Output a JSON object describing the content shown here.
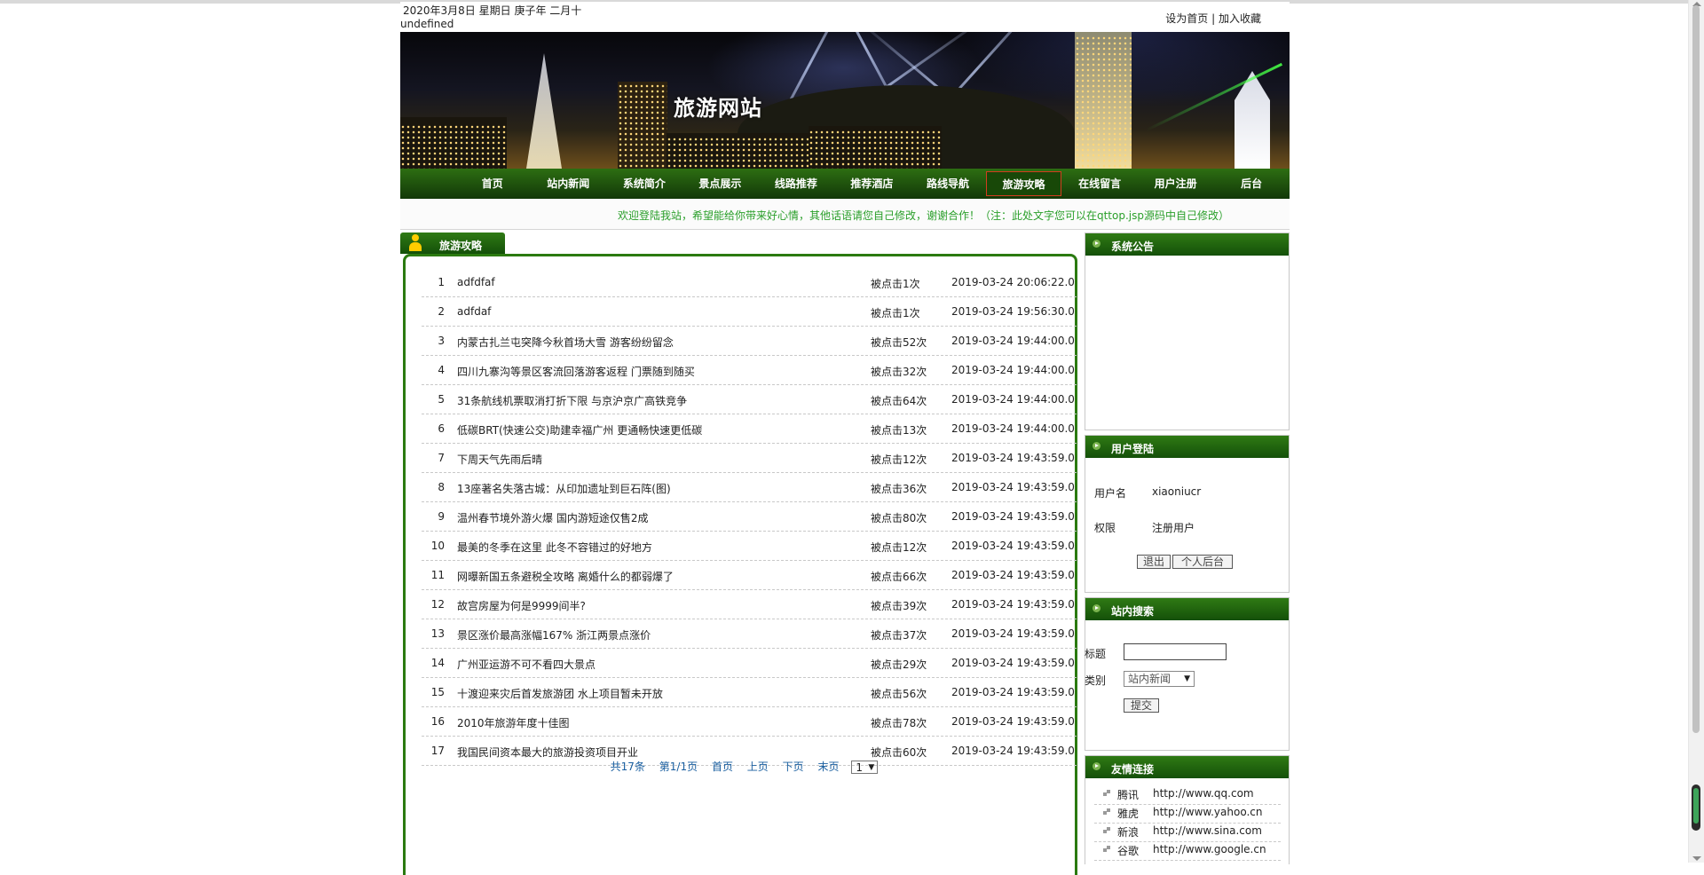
{
  "topbar": {
    "date": "2020年3月8日 星期日 庚子年 二月十",
    "undefined_text": "undefined",
    "set_home": "设为首页",
    "separator": "|",
    "add_favorite": "加入收藏"
  },
  "banner": {
    "title": "旅游网站"
  },
  "nav": {
    "items": [
      "首页",
      "站内新闻",
      "系统简介",
      "景点展示",
      "线路推荐",
      "推荐酒店",
      "路线导航",
      "旅游攻略",
      "在线留言",
      "用户注册",
      "后台"
    ],
    "active": "旅游攻略"
  },
  "welcome": {
    "text": "欢迎登陆我站，希望能给你带来好心情，其他话语请您自己修改，谢谢合作！（注：此处文字您可以在qttop.jsp源码中自己修改）"
  },
  "main": {
    "tab_label": "旅游攻略",
    "articles": [
      {
        "num": "1",
        "title": "adfdfaf",
        "clicks": "被点击1次",
        "date": "2019-03-24 20:06:22.0"
      },
      {
        "num": "2",
        "title": "adfdaf",
        "clicks": "被点击1次",
        "date": "2019-03-24 19:56:30.0"
      },
      {
        "num": "3",
        "title": "内蒙古扎兰屯突降今秋首场大雪 游客纷纷留念",
        "clicks": "被点击52次",
        "date": "2019-03-24 19:44:00.0"
      },
      {
        "num": "4",
        "title": "四川九寨沟等景区客流回落游客返程 门票随到随买",
        "clicks": "被点击32次",
        "date": "2019-03-24 19:44:00.0"
      },
      {
        "num": "5",
        "title": "31条航线机票取消打折下限 与京沪京广高铁竞争",
        "clicks": "被点击64次",
        "date": "2019-03-24 19:44:00.0"
      },
      {
        "num": "6",
        "title": "低碳BRT(快速公交)助建幸福广州 更通畅快速更低碳",
        "clicks": "被点击13次",
        "date": "2019-03-24 19:44:00.0"
      },
      {
        "num": "7",
        "title": "下周天气先雨后晴",
        "clicks": "被点击12次",
        "date": "2019-03-24 19:43:59.0"
      },
      {
        "num": "8",
        "title": "13座著名失落古城：从印加遗址到巨石阵(图)",
        "clicks": "被点击36次",
        "date": "2019-03-24 19:43:59.0"
      },
      {
        "num": "9",
        "title": "温州春节境外游火爆 国内游短途仅售2成",
        "clicks": "被点击80次",
        "date": "2019-03-24 19:43:59.0"
      },
      {
        "num": "10",
        "title": "最美的冬季在这里 此冬不容错过的好地方",
        "clicks": "被点击12次",
        "date": "2019-03-24 19:43:59.0"
      },
      {
        "num": "11",
        "title": "网曝新国五条避税全攻略 离婚什么的都弱爆了",
        "clicks": "被点击66次",
        "date": "2019-03-24 19:43:59.0"
      },
      {
        "num": "12",
        "title": "故宫房屋为何是9999间半?",
        "clicks": "被点击39次",
        "date": "2019-03-24 19:43:59.0"
      },
      {
        "num": "13",
        "title": "景区涨价最高涨幅167% 浙江两景点涨价",
        "clicks": "被点击37次",
        "date": "2019-03-24 19:43:59.0"
      },
      {
        "num": "14",
        "title": "广州亚运游不可不看四大景点",
        "clicks": "被点击29次",
        "date": "2019-03-24 19:43:59.0"
      },
      {
        "num": "15",
        "title": "十渡迎来灾后首发旅游团 水上项目暂未开放",
        "clicks": "被点击56次",
        "date": "2019-03-24 19:43:59.0"
      },
      {
        "num": "16",
        "title": "2010年旅游年度十佳图",
        "clicks": "被点击78次",
        "date": "2019-03-24 19:43:59.0"
      },
      {
        "num": "17",
        "title": "我国民间资本最大的旅游投资项目开业",
        "clicks": "被点击60次",
        "date": "2019-03-24 19:43:59.0"
      }
    ],
    "pagination": {
      "total": "共17条",
      "page_info": "第1/1页",
      "first": "首页",
      "prev": "上页",
      "next": "下页",
      "last": "末页",
      "current_page": "1"
    }
  },
  "sidebar": {
    "notice": {
      "title": "系统公告"
    },
    "login": {
      "title": "用户登陆",
      "username_label": "用户名",
      "username_value": "xiaoniucr",
      "role_label": "权限",
      "role_value": "注册用户",
      "logout_button": "退出",
      "profile_button": "个人后台"
    },
    "search": {
      "title": "站内搜索",
      "title_label": "标题",
      "title_value": "",
      "category_label": "类别",
      "category_value": "站内新闻",
      "submit_button": "提交"
    },
    "links": {
      "title": "友情连接",
      "items": [
        {
          "name": "腾讯",
          "url": "http://www.qq.com"
        },
        {
          "name": "雅虎",
          "url": "http://www.yahoo.cn"
        },
        {
          "name": "新浪",
          "url": "http://www.sina.com"
        },
        {
          "name": "谷歌",
          "url": "http://www.google.cn"
        }
      ]
    }
  },
  "colors": {
    "nav_green": "#1f5a0c",
    "accent_green": "#2b7a10",
    "welcome_green": "#2a9f2a",
    "link_blue": "#1a5fa0",
    "active_border": "#d23d1f"
  }
}
